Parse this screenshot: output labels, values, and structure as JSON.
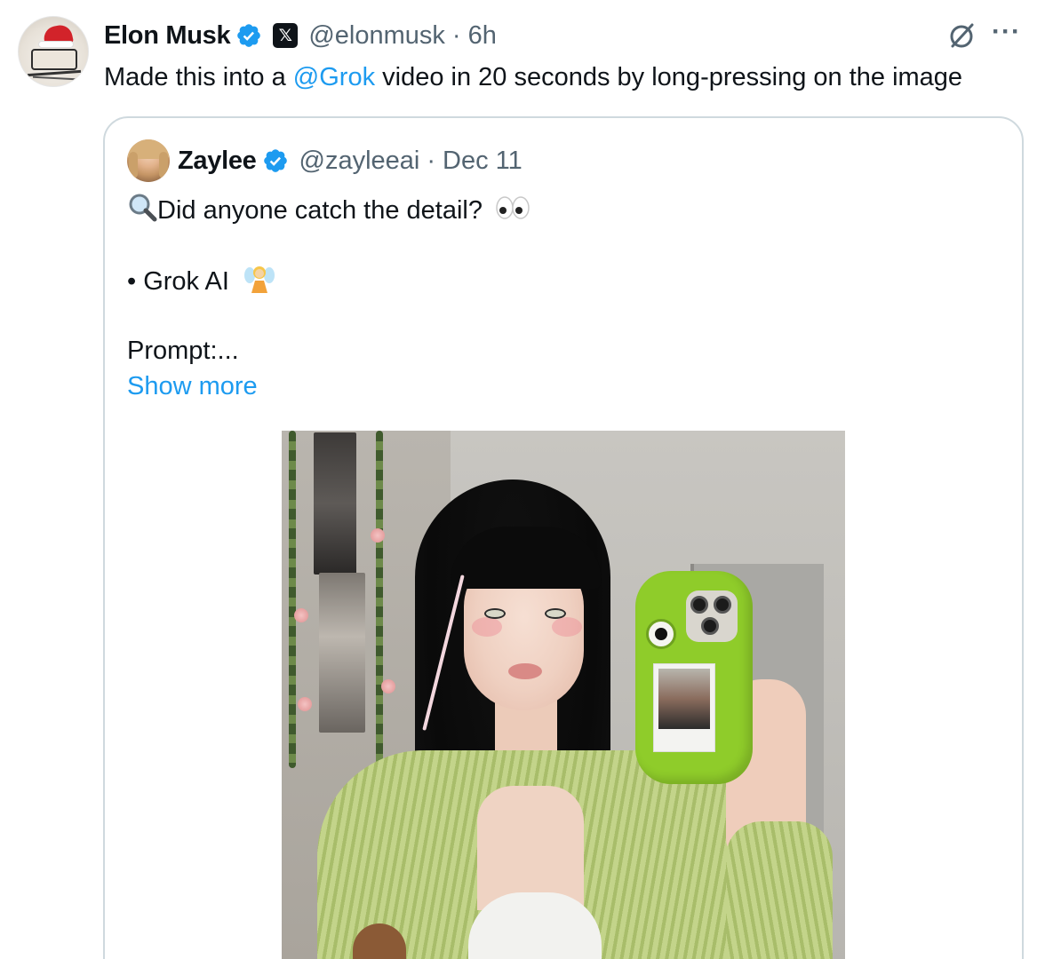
{
  "post": {
    "author": {
      "display_name": "Elon Musk",
      "handle": "@elonmusk",
      "badge_icon": "x-logo-icon",
      "verified_color": "#1d9bf0"
    },
    "separator": "·",
    "time": "6h",
    "text": {
      "prefix": "Made this into a ",
      "mention": "@Grok",
      "suffix": " video in 20 seconds by long-pressing on the image"
    },
    "actions": {
      "grok_icon": "grok-icon",
      "more_label": "···"
    }
  },
  "quote": {
    "author": {
      "display_name": "Zaylee",
      "handle": "@zayleeai"
    },
    "separator": "·",
    "time": "Dec 11",
    "line1": "Did anyone catch the detail?",
    "line2": "• Grok AI",
    "line3": "Prompt:...",
    "show_more": "Show more",
    "emoji": {
      "magnifier": "magnifying-glass-icon",
      "eyes": "eyes-icon",
      "fairy": "fairy-icon"
    }
  },
  "colors": {
    "link": "#1d9bf0",
    "secondary_text": "#536471",
    "border": "#cfd9de"
  }
}
